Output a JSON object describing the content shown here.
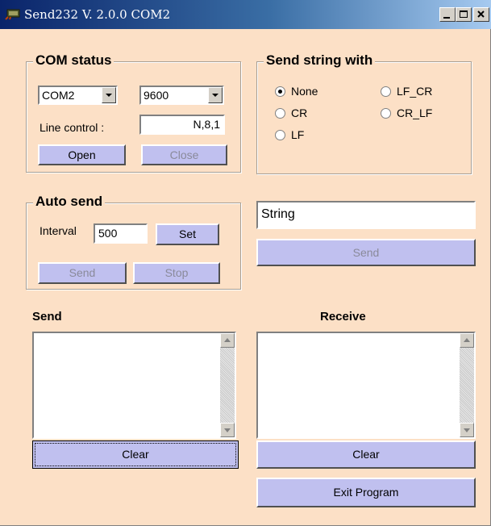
{
  "window": {
    "title": "Send232  V. 2.0.0 COM2"
  },
  "com_status": {
    "legend": "COM status",
    "port": "COM2",
    "baud": "9600",
    "line_control_label": "Line control :",
    "line_control_value": "N,8,1",
    "open_label": "Open",
    "close_label": "Close"
  },
  "send_with": {
    "legend": "Send string with",
    "options": [
      {
        "label": "None",
        "selected": true
      },
      {
        "label": "LF_CR",
        "selected": false
      },
      {
        "label": "CR",
        "selected": false
      },
      {
        "label": "CR_LF",
        "selected": false
      },
      {
        "label": "LF",
        "selected": false
      }
    ]
  },
  "auto_send": {
    "legend": "Auto send",
    "interval_label": "Interval",
    "interval_value": "500",
    "set_label": "Set",
    "send_label": "Send",
    "stop_label": "Stop"
  },
  "string_input": {
    "value": "String"
  },
  "send_string_label": "Send",
  "send_panel": {
    "title": "Send",
    "clear_label": "Clear"
  },
  "receive_panel": {
    "title": "Receive",
    "clear_label": "Clear"
  },
  "exit_label": "Exit Program",
  "icons": [
    "app-icon",
    "minimize-icon",
    "maximize-icon",
    "close-icon",
    "dropdown-arrow-icon",
    "scroll-up-icon",
    "scroll-down-icon"
  ]
}
